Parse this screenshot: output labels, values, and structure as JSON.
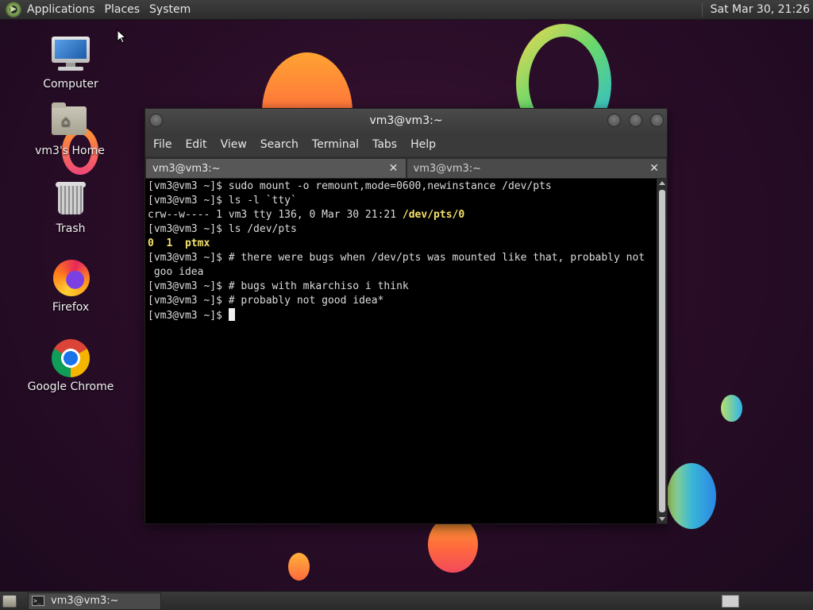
{
  "top_panel": {
    "menus": [
      "Applications",
      "Places",
      "System"
    ],
    "clock": "Sat Mar 30, 21:26",
    "logo_icon": "distro-logo-icon"
  },
  "desktop": {
    "icons": [
      {
        "label": "Computer",
        "icon": "computer-icon"
      },
      {
        "label": "vm3's Home",
        "icon": "home-folder-icon"
      },
      {
        "label": "Trash",
        "icon": "trash-icon"
      },
      {
        "label": "Firefox",
        "icon": "firefox-icon"
      },
      {
        "label": "Google Chrome",
        "icon": "chrome-icon"
      }
    ]
  },
  "window": {
    "title": "vm3@vm3:~",
    "menu": [
      "File",
      "Edit",
      "View",
      "Search",
      "Terminal",
      "Tabs",
      "Help"
    ],
    "tabs": [
      {
        "label": "vm3@vm3:~",
        "active": true
      },
      {
        "label": "vm3@vm3:~",
        "active": false
      }
    ],
    "terminal_lines": [
      "[vm3@vm3 ~]$ sudo mount -o remount,mode=0600,newinstance /dev/pts",
      "[vm3@vm3 ~]$ ls -l `tty`",
      "crw--w---- 1 vm3 tty 136, 0 Mar 30 21:21 ",
      "/dev/pts/0",
      "[vm3@vm3 ~]$ ls /dev/pts",
      "0  1  ptmx",
      "[vm3@vm3 ~]$ # there were bugs when /dev/pts was mounted like that, probably not",
      " goo idea",
      "[vm3@vm3 ~]$ # bugs with mkarchiso i think",
      "[vm3@vm3 ~]$ # probably not good idea*",
      "[vm3@vm3 ~]$ "
    ]
  },
  "bottom_panel": {
    "task_label": "vm3@vm3:~"
  },
  "colors": {
    "terminal_bg": "#000000",
    "highlight_yellow": "#f5e16b"
  }
}
